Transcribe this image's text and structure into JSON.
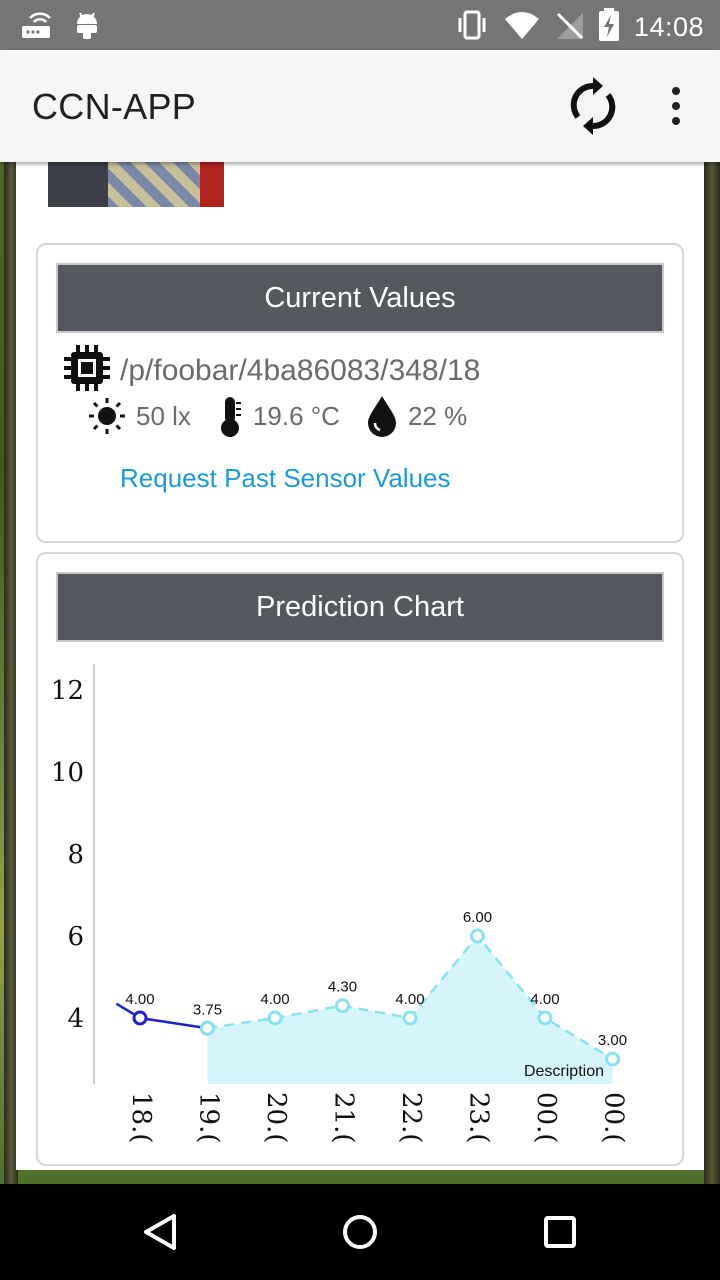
{
  "status_bar": {
    "time": "14:08"
  },
  "app_bar": {
    "title": "CCN-APP"
  },
  "current_values": {
    "header": "Current Values",
    "sensor_path": "/p/foobar/4ba86083/348/18",
    "light": "50 lx",
    "temperature": "19.6 °C",
    "humidity": "22 %",
    "request_link": "Request Past Sensor Values"
  },
  "prediction": {
    "header": "Prediction Chart"
  },
  "chart_data": {
    "type": "line",
    "categories": [
      "18.(",
      "19.(",
      "20.(",
      "21.(",
      "22.(",
      "23.(",
      "00.(",
      "00.("
    ],
    "yticks": [
      "12",
      "10",
      "8",
      "6",
      "4"
    ],
    "ylim": [
      2.3,
      12.5
    ],
    "series": [
      {
        "name": "",
        "style": "solid",
        "color": "#1f22c8",
        "points": [
          [
            -0.35,
            4.35
          ],
          [
            0,
            4.0
          ],
          [
            1,
            3.75
          ]
        ],
        "labels": [
          "",
          "4.00",
          "3.75"
        ]
      },
      {
        "name": "",
        "style": "dashed",
        "color": "#86e3ef",
        "fill": "#d6f5fb",
        "points": [
          [
            1,
            3.75
          ],
          [
            2,
            4.0
          ],
          [
            3,
            4.3
          ],
          [
            4,
            4.0
          ],
          [
            5,
            6.0
          ],
          [
            6,
            4.0
          ],
          [
            7,
            3.0
          ]
        ],
        "labels": [
          "",
          "4.00",
          "4.30",
          "4.00",
          "6.00",
          "4.00",
          "3.00"
        ]
      }
    ],
    "description": "Description"
  }
}
